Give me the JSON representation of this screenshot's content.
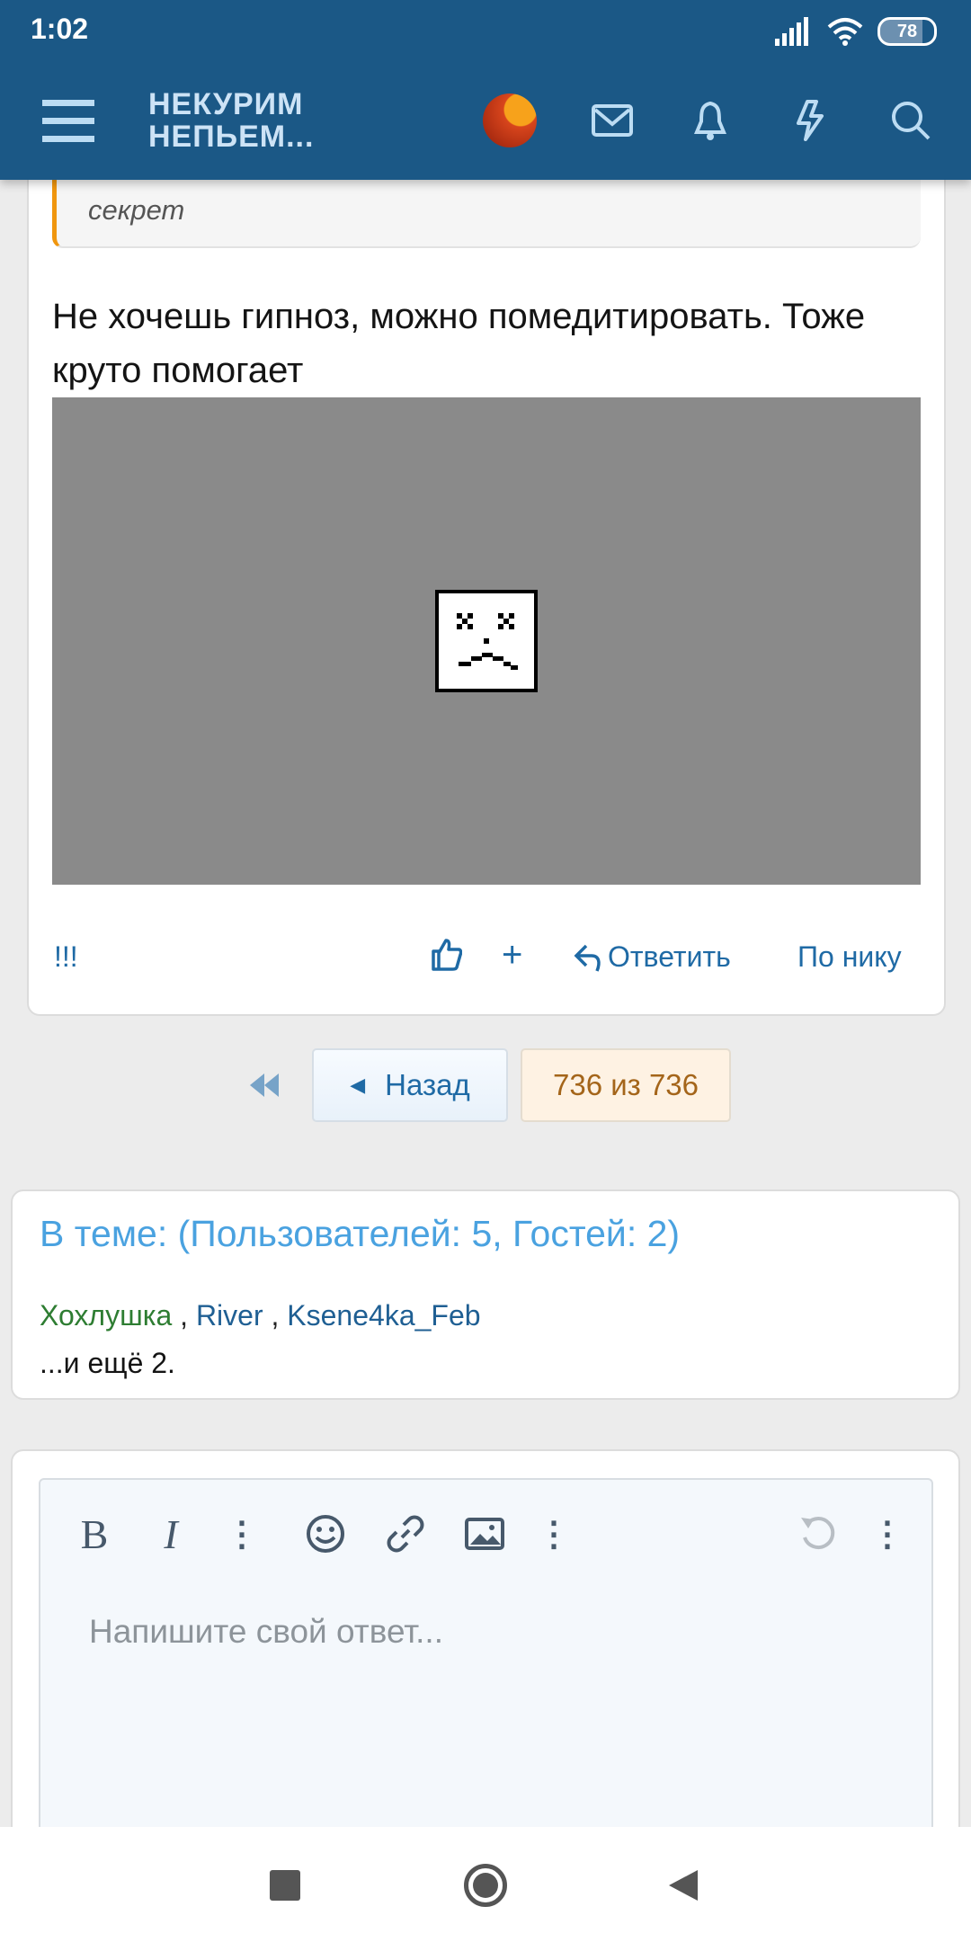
{
  "status_bar": {
    "time": "1:02",
    "battery": "78"
  },
  "header": {
    "logo_line1": "НЕКУРИМ",
    "logo_line2": "НЕПЬЕМ..."
  },
  "post": {
    "quote": "секрет",
    "text": "Не хочешь гипноз, можно помедитировать. Тоже круто помогает",
    "actions": {
      "report": "!!!",
      "reply": "Ответить",
      "by_nick": "По нику"
    }
  },
  "pager": {
    "back": "Назад",
    "current": "736 из 736"
  },
  "online": {
    "title": "В теме: (Пользователей: 5, Гостей: 2)",
    "users": [
      {
        "name": "Хохлушка",
        "color": "#2e7d32"
      },
      {
        "name": "River",
        "color": "#1f5f93"
      },
      {
        "name": "Ksene4ka_Feb",
        "color": "#1f5f93"
      }
    ],
    "more": "...и ещё 2."
  },
  "editor": {
    "placeholder": "Напишите свой ответ..."
  },
  "colors": {
    "header": "#1b5886",
    "link": "#1f6aa5",
    "quote_bar": "#f0960e"
  }
}
